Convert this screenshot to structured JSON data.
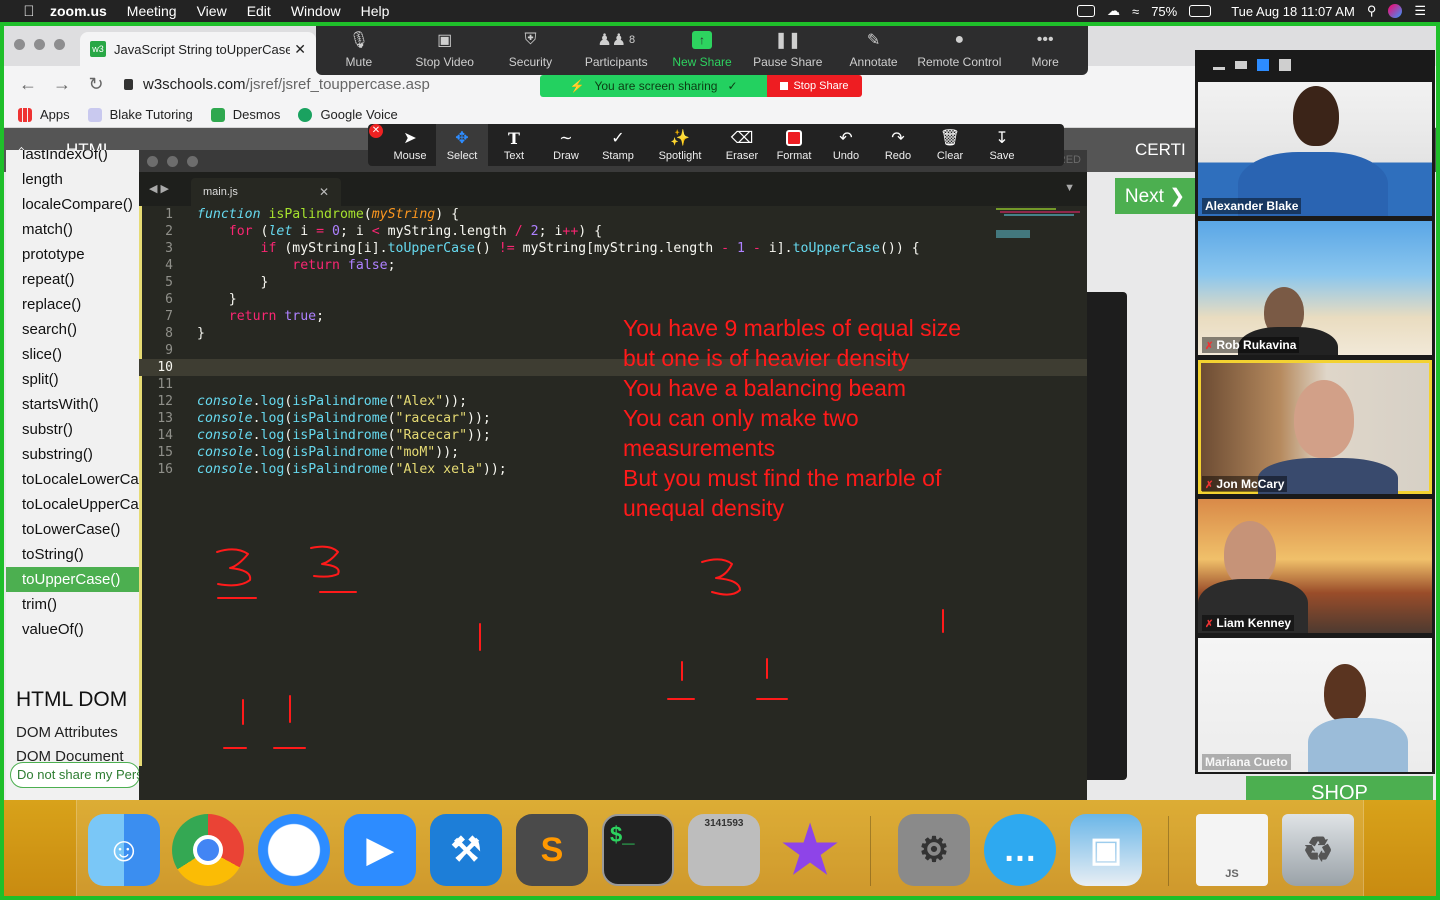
{
  "menubar": {
    "app": "zoom.us",
    "items": [
      "Meeting",
      "View",
      "Edit",
      "Window",
      "Help"
    ],
    "battery": "75%",
    "clock": "Tue Aug 18  11:07 AM"
  },
  "browser": {
    "tab_title": "JavaScript String toUpperCase",
    "url_domain": "w3schools.com",
    "url_path": "/jsref/jsref_touppercase.asp",
    "bookmarks": [
      "Apps",
      "Blake Tutoring",
      "Desmos",
      "Google Voice"
    ]
  },
  "w3": {
    "nav_html": "HTML",
    "nav_certi": "CERTI",
    "next": "Next ❯",
    "sidebar": [
      "lastIndexOf()",
      "length",
      "localeCompare()",
      "match()",
      "prototype",
      "repeat()",
      "replace()",
      "search()",
      "slice()",
      "split()",
      "startsWith()",
      "substr()",
      "substring()",
      "toLocaleLowerCase()",
      "toLocaleUpperCase()",
      "toLowerCase()",
      "toString()",
      "toUpperCase()",
      "trim()",
      "valueOf()"
    ],
    "active_item": "toUpperCase()",
    "dom_heading": "HTML DOM",
    "dom_attributes": "DOM Attributes",
    "dom_document": "DOM Document",
    "do_not_share": "Do not share my Personal Information",
    "shop": "SHOP"
  },
  "editor": {
    "tab": "main.js",
    "registered": "STERED",
    "line_numbers": [
      "1",
      "2",
      "3",
      "4",
      "5",
      "6",
      "7",
      "8",
      "9",
      "10",
      "11",
      "12",
      "13",
      "14",
      "15",
      "16"
    ],
    "current_line": "10"
  },
  "zoom": {
    "toolbar": [
      {
        "label": "Mute",
        "icon": "microphone-icon"
      },
      {
        "label": "Stop Video",
        "icon": "video-camera-icon"
      },
      {
        "label": "Security",
        "icon": "shield-icon"
      },
      {
        "label": "Participants",
        "icon": "participants-icon",
        "count": "8"
      },
      {
        "label": "New Share",
        "icon": "share-arrow-icon"
      },
      {
        "label": "Pause Share",
        "icon": "pause-icon"
      },
      {
        "label": "Annotate",
        "icon": "pencil-icon"
      },
      {
        "label": "Remote Control",
        "icon": "mouse-icon"
      },
      {
        "label": "More",
        "icon": "ellipsis-icon"
      }
    ],
    "sharing_msg": "You are screen sharing",
    "stop_share": "Stop Share",
    "annotate_tools": [
      "Mouse",
      "Select",
      "Text",
      "Draw",
      "Stamp",
      "Spotlight",
      "Eraser",
      "Format",
      "Undo",
      "Redo",
      "Clear",
      "Save"
    ],
    "selected_tool": "Select",
    "participants": [
      {
        "name": "Alexander Blake",
        "muted": false
      },
      {
        "name": "Rob Rukavina",
        "muted": true
      },
      {
        "name": "Jon McCary",
        "muted": true
      },
      {
        "name": "Liam Kenney",
        "muted": true
      },
      {
        "name": "Mariana Cueto",
        "muted": false
      }
    ],
    "active_speaker": "Jon McCary"
  },
  "annotation_text": [
    "You have 9 marbles of equal size",
    "but one is of heavier density",
    "You have a balancing beam",
    "You can only make two",
    "measurements",
    "But you must find the marble of",
    "unequal density"
  ],
  "drawn_numbers": [
    "3",
    "3",
    "3"
  ],
  "dock_label_calc": "3141593",
  "dock_label_js": "JS",
  "colors": {
    "share_green": "#1fbf2a",
    "w3_green": "#4caf50",
    "annotation_red": "#ff1a1a",
    "zoom_blue": "#2d8cff",
    "stop_red": "#ee1d22"
  }
}
